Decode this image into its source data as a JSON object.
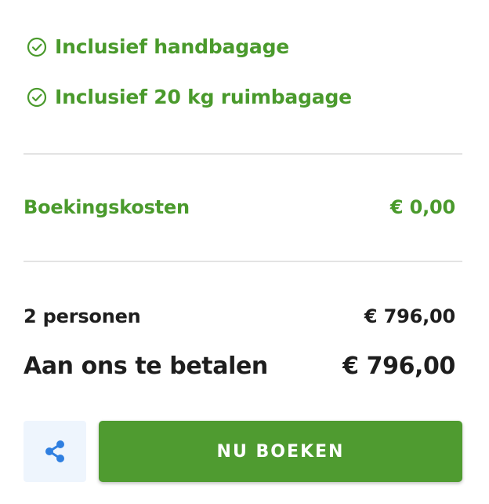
{
  "features": [
    {
      "label": "Inclusief handbagage",
      "icon": "check-circle-icon"
    },
    {
      "label": "Inclusief 20 kg ruimbagage",
      "icon": "check-circle-icon"
    }
  ],
  "fee": {
    "label": "Boekingskosten",
    "value": "€ 0,00"
  },
  "persons": {
    "label": "2 personen",
    "value": "€ 796,00"
  },
  "total": {
    "label": "Aan ons te betalen",
    "value": "€ 796,00"
  },
  "actions": {
    "share_icon": "share-icon",
    "book_label": "NU BOEKEN"
  },
  "colors": {
    "accent_green": "#4a9a2c",
    "button_green": "#4f9b30",
    "share_blue": "#2f7fe0",
    "share_bg": "#eef5fd",
    "text_dark": "#1e1e1e",
    "divider": "#e3e3e3"
  }
}
